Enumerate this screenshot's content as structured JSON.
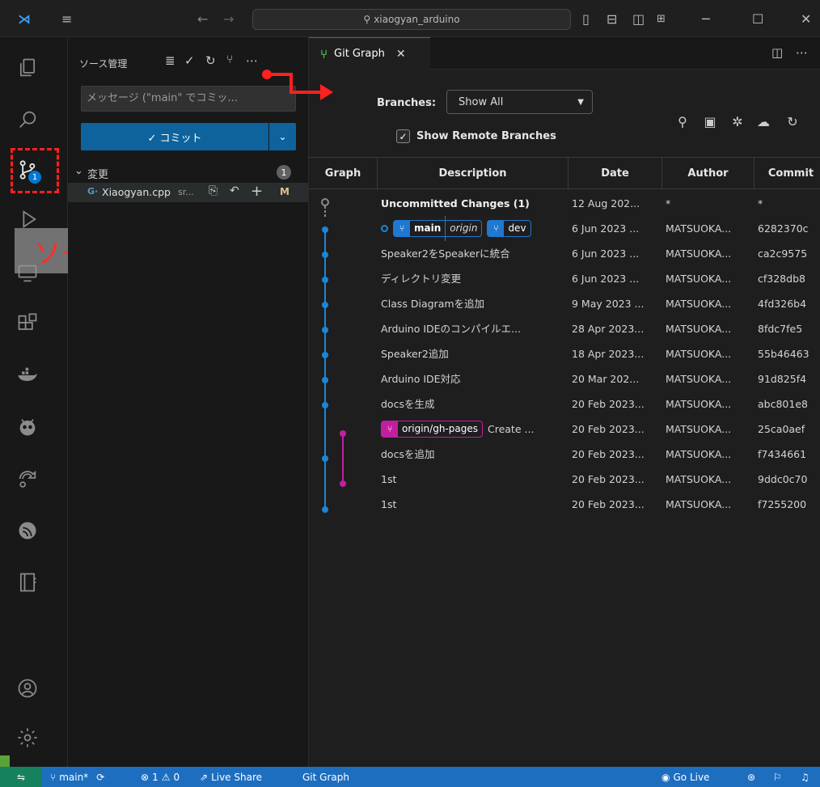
{
  "title_bar": {
    "search_text": "xiaogyan_arduino"
  },
  "sidebar": {
    "title": "ソース管理",
    "message_placeholder": "メッセージ (\"main\" でコミッ...",
    "commit_label": "✓ コミット",
    "changes_label": "変更",
    "changes_count": "1",
    "file_name": "Xiaogyan.cpp",
    "file_path": "sr...",
    "file_status": "M"
  },
  "annotation": {
    "label": "ソース管理"
  },
  "activity_bar": {
    "badge": "1"
  },
  "tab": {
    "label": "Git Graph"
  },
  "git_graph": {
    "branches_label": "Branches:",
    "branches_value": "Show All",
    "remote_label": "Show Remote Branches",
    "columns": [
      "Graph",
      "Description",
      "Date",
      "Author",
      "Commit"
    ],
    "rows": [
      {
        "description": "Uncommitted Changes (1)",
        "date": "12 Aug 202...",
        "author": "*",
        "commit": "*"
      },
      {
        "description": "",
        "date": "6 Jun 2023 ...",
        "author": "MATSUOKA...",
        "commit": "6282370c"
      },
      {
        "description": "Speaker2をSpeakerに統合",
        "date": "6 Jun 2023 ...",
        "author": "MATSUOKA...",
        "commit": "ca2c9575"
      },
      {
        "description": "ディレクトリ変更",
        "date": "6 Jun 2023 ...",
        "author": "MATSUOKA...",
        "commit": "cf328db8"
      },
      {
        "description": "Class Diagramを追加",
        "date": "9 May 2023 ...",
        "author": "MATSUOKA...",
        "commit": "4fd326b4"
      },
      {
        "description": "Arduino IDEのコンパイルエ...",
        "date": "28 Apr 2023...",
        "author": "MATSUOKA...",
        "commit": "8fdc7fe5"
      },
      {
        "description": "Speaker2追加",
        "date": "18 Apr 2023...",
        "author": "MATSUOKA...",
        "commit": "55b46463"
      },
      {
        "description": "Arduino IDE対応",
        "date": "20 Mar 202...",
        "author": "MATSUOKA...",
        "commit": "91d825f4"
      },
      {
        "description": "docsを生成",
        "date": "20 Feb 2023...",
        "author": "MATSUOKA...",
        "commit": "abc801e8"
      },
      {
        "description": "Create ...",
        "date": "20 Feb 2023...",
        "author": "MATSUOKA...",
        "commit": "25ca0aef"
      },
      {
        "description": "docsを追加",
        "date": "20 Feb 2023...",
        "author": "MATSUOKA...",
        "commit": "f7434661"
      },
      {
        "description": "1st",
        "date": "20 Feb 2023...",
        "author": "MATSUOKA...",
        "commit": "9ddc0c70"
      },
      {
        "description": "1st",
        "date": "20 Feb 2023...",
        "author": "MATSUOKA...",
        "commit": "f7255200"
      }
    ],
    "refs": {
      "main": "main",
      "main_remote": "origin",
      "dev": "dev",
      "gh_pages": "origin/gh-pages"
    }
  },
  "status_bar": {
    "branch": "main*",
    "errors": "1",
    "warnings": "0",
    "live_share": "Live Share",
    "git_graph": "Git Graph",
    "go_live": "Go Live"
  },
  "colors": {
    "accent": "#0078d4",
    "statusbar": "#1e6ec0",
    "branch_blue": "#1f78d1",
    "branch_pink": "#c41ea0",
    "annotation": "#ff2d2d"
  }
}
